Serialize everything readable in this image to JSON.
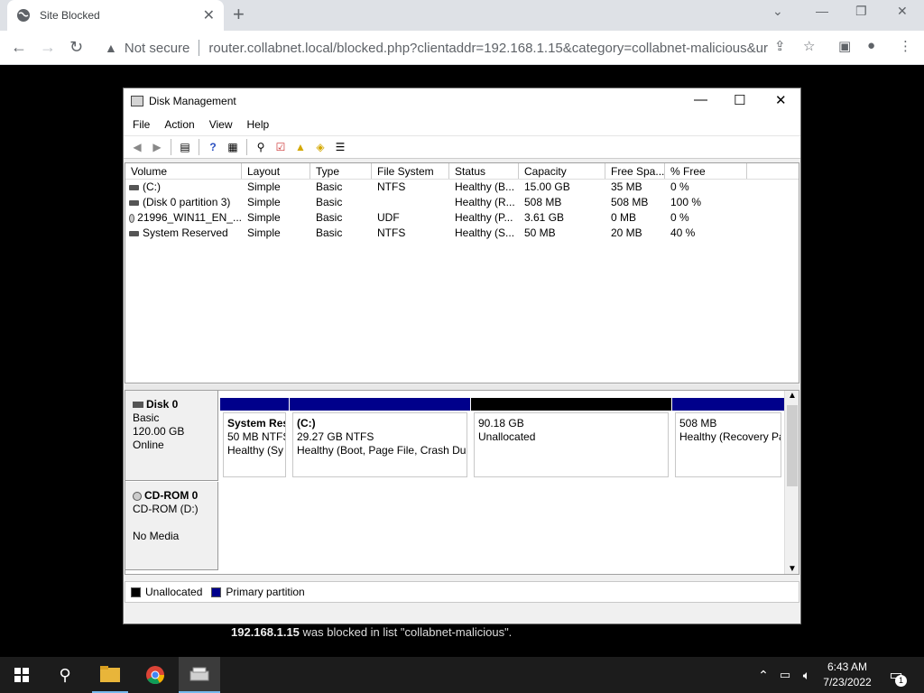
{
  "browser": {
    "tab_title": "Site Blocked",
    "security_label": "Not secure",
    "url": "router.collabnet.local/blocked.php?clientaddr=192.168.1.15&category=collabnet-malicious&url=gi..."
  },
  "window": {
    "title": "Disk Management",
    "menu": [
      "File",
      "Action",
      "View",
      "Help"
    ]
  },
  "volume_table": {
    "headers": [
      "Volume",
      "Layout",
      "Type",
      "File System",
      "Status",
      "Capacity",
      "Free Spa...",
      "% Free"
    ],
    "rows": [
      [
        "(C:)",
        "Simple",
        "Basic",
        "NTFS",
        "Healthy (B...",
        "15.00 GB",
        "35 MB",
        "0 %"
      ],
      [
        "(Disk 0 partition 3)",
        "Simple",
        "Basic",
        "",
        "Healthy (R...",
        "508 MB",
        "508 MB",
        "100 %"
      ],
      [
        "21996_WIN11_EN_...",
        "Simple",
        "Basic",
        "UDF",
        "Healthy (P...",
        "3.61 GB",
        "0 MB",
        "0 %"
      ],
      [
        "System Reserved",
        "Simple",
        "Basic",
        "NTFS",
        "Healthy (S...",
        "50 MB",
        "20 MB",
        "40 %"
      ]
    ]
  },
  "disks": {
    "disk0": {
      "name": "Disk 0",
      "type": "Basic",
      "size": "120.00 GB",
      "state": "Online",
      "partitions": [
        {
          "name": "System Res",
          "size": "50 MB NTFS",
          "status": "Healthy (Sy",
          "color": "#00008b"
        },
        {
          "name": "(C:)",
          "size": "29.27 GB NTFS",
          "status": "Healthy (Boot, Page File, Crash Dur",
          "color": "#00008b"
        },
        {
          "name": "",
          "size": "90.18 GB",
          "status": "Unallocated",
          "color": "#000000"
        },
        {
          "name": "",
          "size": "508 MB",
          "status": "Healthy (Recovery Pa",
          "color": "#00008b"
        }
      ]
    },
    "cdrom0": {
      "name": "CD-ROM 0",
      "type": "CD-ROM (D:)",
      "media": "No Media"
    }
  },
  "legend": {
    "unallocated": "Unallocated",
    "primary": "Primary partition",
    "unallocated_color": "#000000",
    "primary_color": "#00008b"
  },
  "block_message": {
    "ip": "192.168.1.15",
    "text": " was blocked in list \"collabnet-malicious\"."
  },
  "taskbar": {
    "time": "6:43 AM",
    "date": "7/23/2022",
    "notification_count": "1"
  }
}
